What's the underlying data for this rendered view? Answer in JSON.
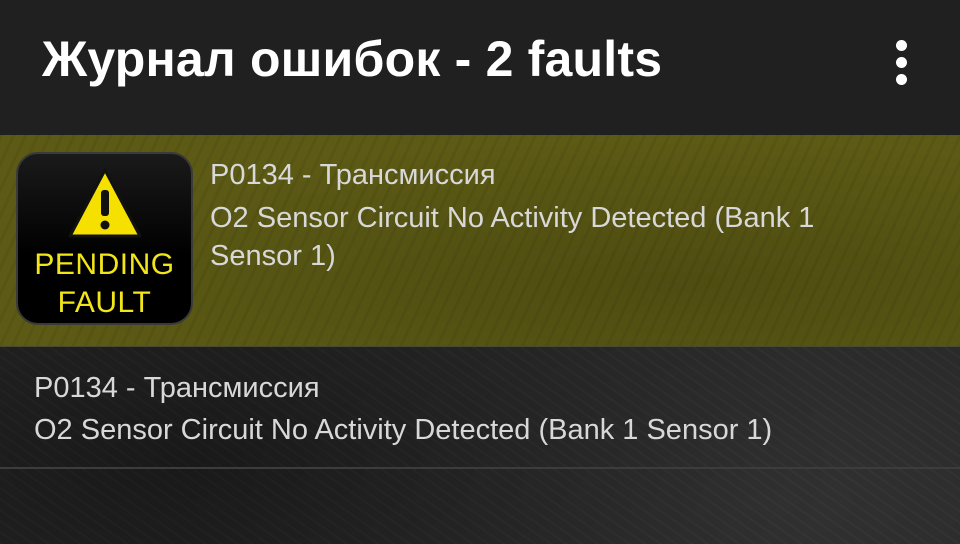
{
  "app_bar": {
    "title": "Журнал ошибок - 2 faults",
    "overflow_icon": "more-vert-icon"
  },
  "faults": [
    {
      "status": "pending",
      "badge": {
        "line1": "PENDING",
        "line2": "FAULT",
        "icon": "warning-triangle-icon"
      },
      "code": "P0134 - Трансмиссия",
      "description": "O2 Sensor Circuit No Activity Detected (Bank 1 Sensor 1)"
    },
    {
      "status": "stored",
      "code": "P0134 - Трансмиссия",
      "description": "O2 Sensor Circuit No Activity Detected (Bank 1 Sensor 1)"
    }
  ],
  "colors": {
    "app_bar_bg": "#202020",
    "pending_row_bg": "#5c5a14",
    "badge_text": "#f2e51a",
    "warning_yellow": "#f5e000",
    "text": "#d8d8d8"
  }
}
